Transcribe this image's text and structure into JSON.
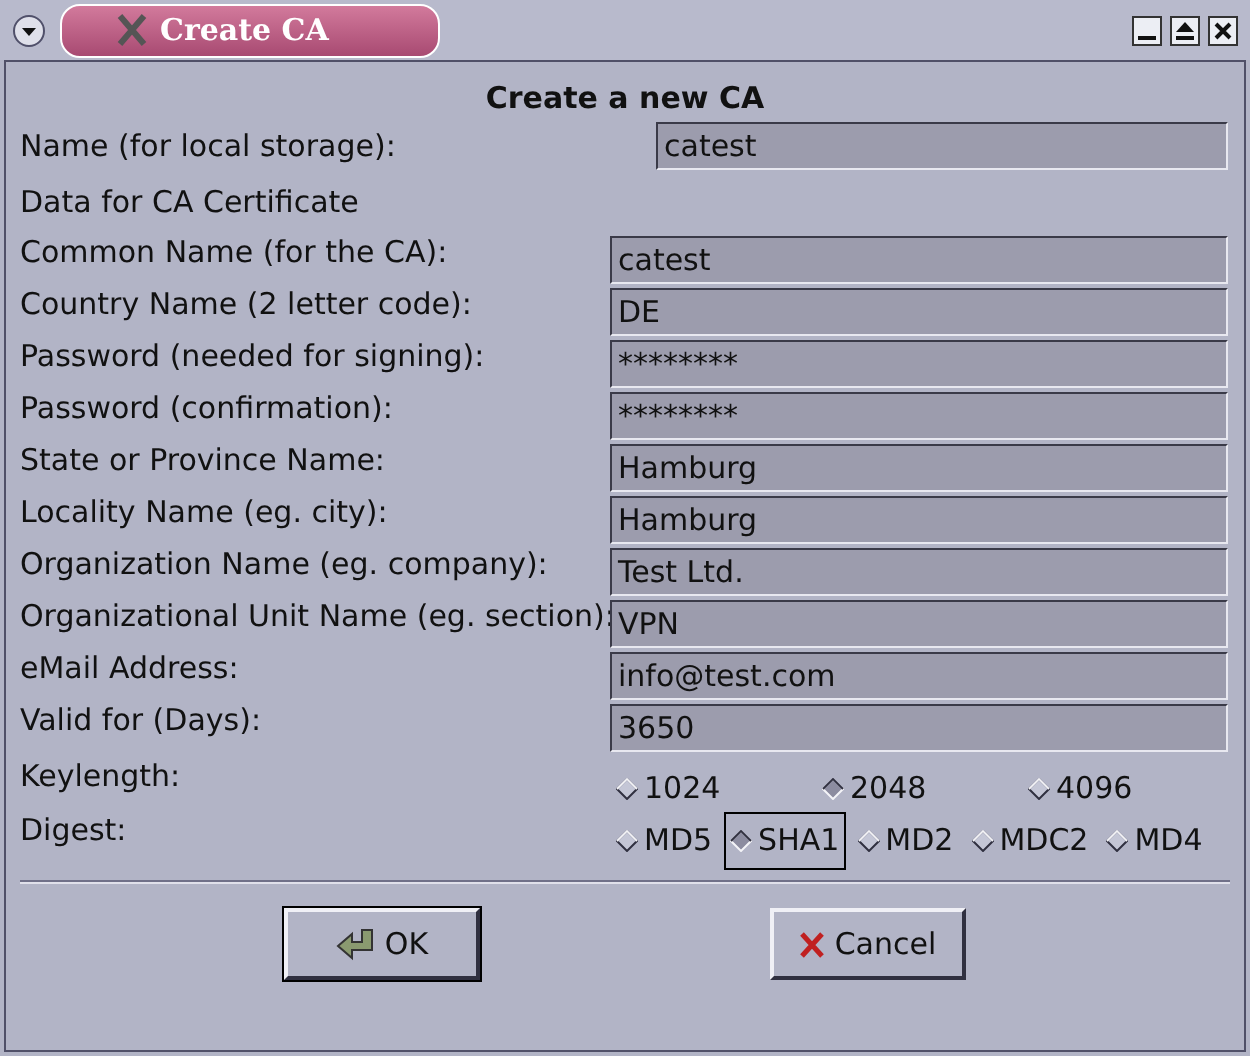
{
  "window": {
    "title": "Create CA"
  },
  "heading": "Create a new CA",
  "name_field": {
    "label": "Name (for local storage):",
    "value": "catest"
  },
  "section_label": "Data for CA Certificate",
  "fields": [
    {
      "label": "Common Name (for the CA):",
      "value": "catest"
    },
    {
      "label": "Country Name (2 letter code):",
      "value": "DE"
    },
    {
      "label": "Password (needed for signing):",
      "value": "********"
    },
    {
      "label": "Password (confirmation):",
      "value": "********"
    },
    {
      "label": "State or Province Name:",
      "value": "Hamburg"
    },
    {
      "label": "Locality Name (eg. city):",
      "value": "Hamburg"
    },
    {
      "label": "Organization Name (eg. company):",
      "value": "Test Ltd."
    },
    {
      "label": "Organizational Unit Name (eg. section):",
      "value": "VPN"
    },
    {
      "label": "eMail Address:",
      "value": "info@test.com"
    },
    {
      "label": "Valid for (Days):",
      "value": "3650"
    }
  ],
  "keylength": {
    "label": "Keylength:",
    "options": [
      {
        "label": "1024",
        "selected": false
      },
      {
        "label": "2048",
        "selected": true
      },
      {
        "label": "4096",
        "selected": false
      }
    ]
  },
  "digest": {
    "label": "Digest:",
    "options": [
      {
        "label": "MD5",
        "selected": false
      },
      {
        "label": "SHA1",
        "selected": true
      },
      {
        "label": "MD2",
        "selected": false
      },
      {
        "label": "MDC2",
        "selected": false
      },
      {
        "label": "MD4",
        "selected": false
      }
    ]
  },
  "buttons": [
    {
      "kind": "ok",
      "label": "OK"
    },
    {
      "kind": "cancel",
      "label": "Cancel"
    }
  ]
}
